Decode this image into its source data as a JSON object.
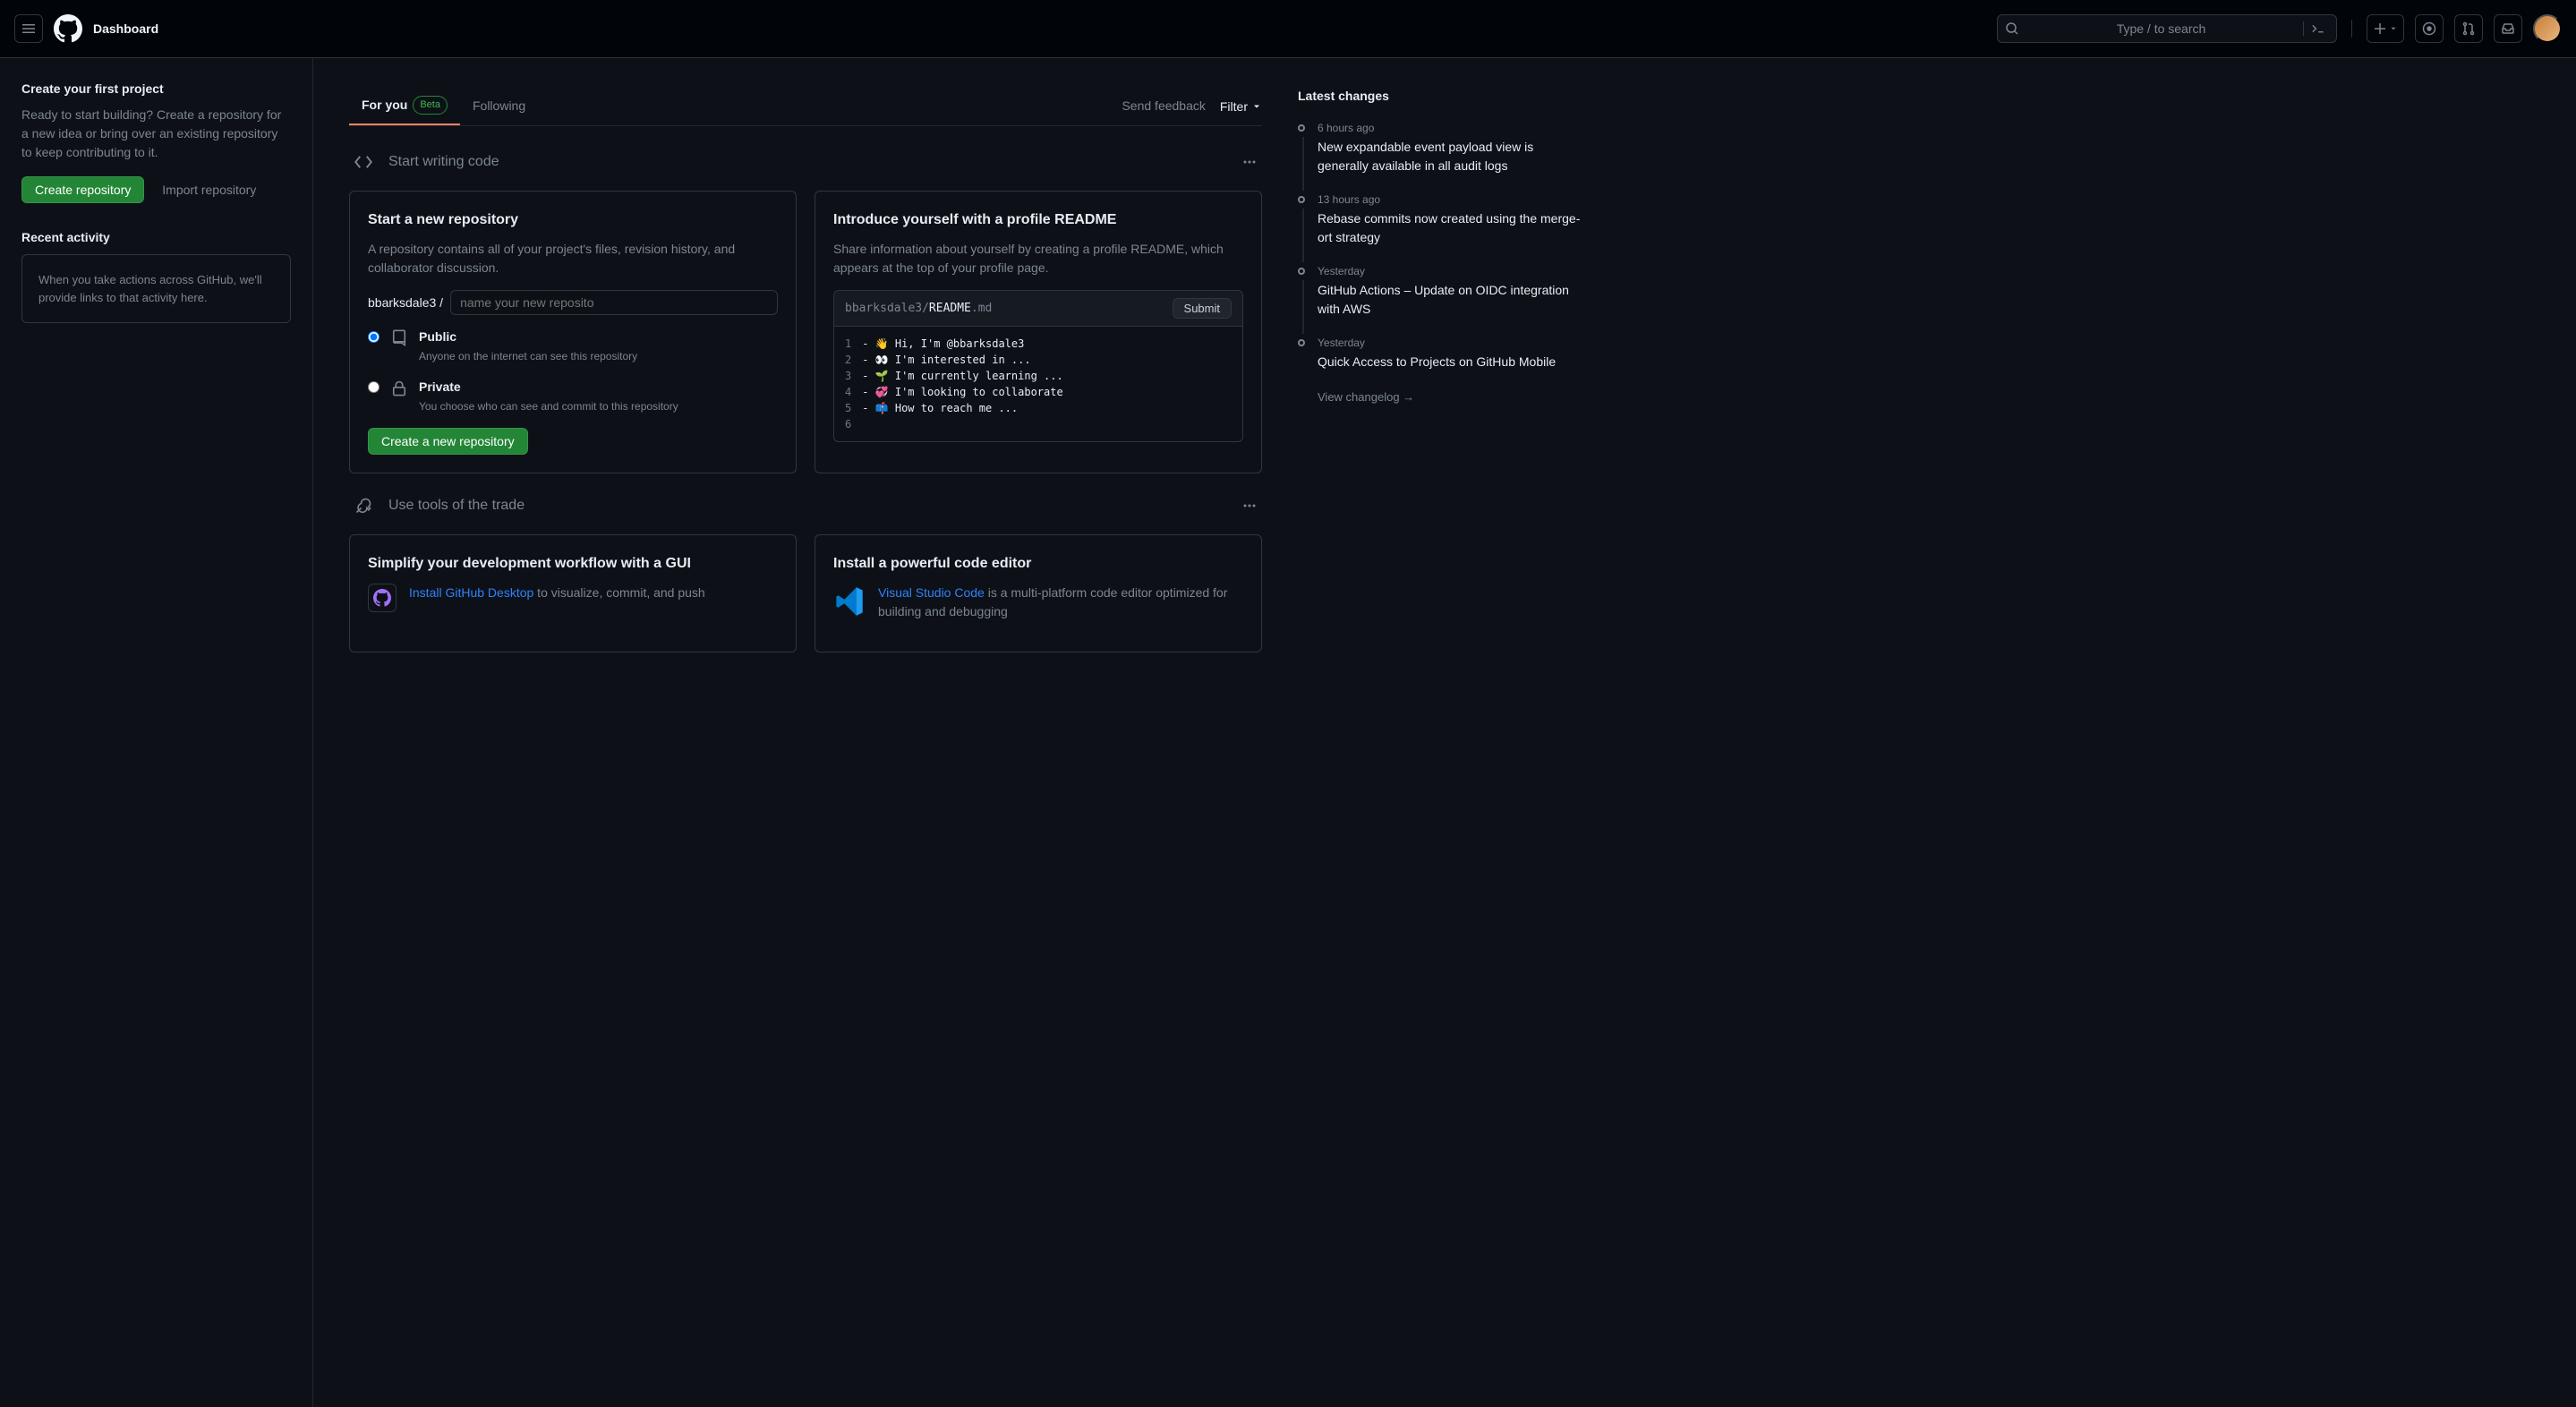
{
  "header": {
    "dashboard": "Dashboard",
    "search_placeholder": "Type / to search"
  },
  "sidebar": {
    "first_project": {
      "title": "Create your first project",
      "body": "Ready to start building? Create a repository for a new idea or bring over an existing repository to keep contributing to it.",
      "create_btn": "Create repository",
      "import_link": "Import repository"
    },
    "recent": {
      "title": "Recent activity",
      "body": "When you take actions across GitHub, we'll provide links to that activity here."
    }
  },
  "tabs": {
    "for_you": "For you",
    "beta": "Beta",
    "following": "Following",
    "send_feedback": "Send feedback",
    "filter": "Filter"
  },
  "sections": {
    "writing_code": "Start writing code",
    "tools": "Use tools of the trade"
  },
  "repo_card": {
    "title": "Start a new repository",
    "body": "A repository contains all of your project's files, revision history, and collaborator discussion.",
    "owner": "bbarksdale3 /",
    "name_placeholder": "name your new reposito",
    "public": {
      "label": "Public",
      "desc": "Anyone on the internet can see this repository"
    },
    "private": {
      "label": "Private",
      "desc": "You choose who can see and commit to this repository"
    },
    "create_btn": "Create a new repository"
  },
  "readme_card": {
    "title": "Introduce yourself with a profile README",
    "body": "Share information about yourself by creating a profile README, which appears at the top of your profile page.",
    "path_owner": "bbarksdale3",
    "path_file": "README",
    "path_ext": ".md",
    "submit": "Submit",
    "lines": [
      "- 👋 Hi, I'm @bbarksdale3",
      "- 👀 I'm interested in ...",
      "- 🌱 I'm currently learning ...",
      "- 💞️ I'm looking to collaborate",
      "- 📫 How to reach me ...",
      ""
    ]
  },
  "simplify_card": {
    "title": "Simplify your development workflow with a GUI",
    "link": "Install GitHub Desktop",
    "body_start": " to visualize, commit, and push"
  },
  "editor_card": {
    "title": "Install a powerful code editor",
    "link": "Visual Studio Code",
    "body": " is a multi-platform code editor optimized for building and debugging"
  },
  "changes": {
    "title": "Latest changes",
    "items": [
      {
        "time": "6 hours ago",
        "title": "New expandable event payload view is generally available in all audit logs"
      },
      {
        "time": "13 hours ago",
        "title": "Rebase commits now created using the merge-ort strategy"
      },
      {
        "time": "Yesterday",
        "title": "GitHub Actions – Update on OIDC integration with AWS"
      },
      {
        "time": "Yesterday",
        "title": "Quick Access to Projects on GitHub Mobile"
      }
    ],
    "view_all": "View changelog →"
  }
}
